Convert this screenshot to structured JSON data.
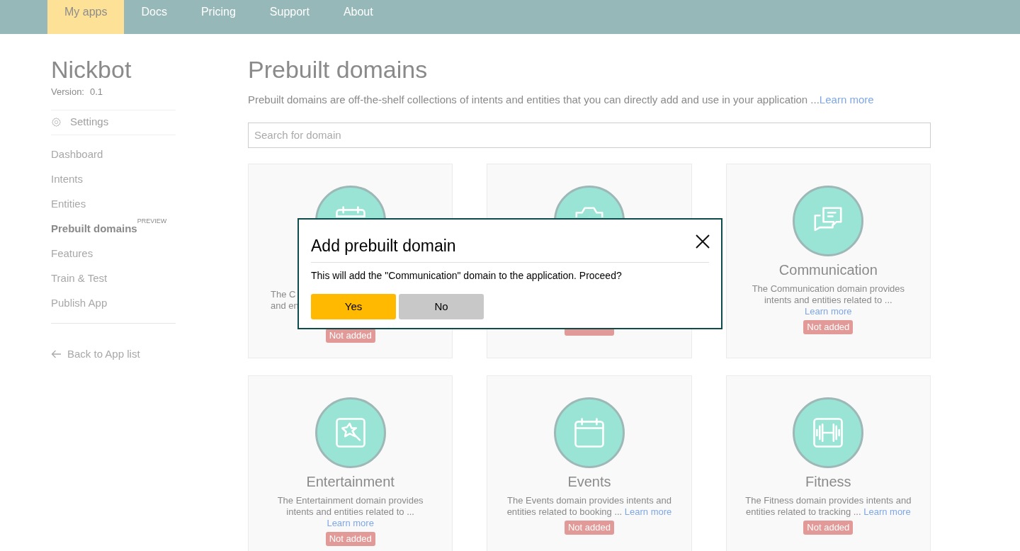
{
  "nav": [
    {
      "label": "My apps",
      "selected": true
    },
    {
      "label": "Docs",
      "selected": false
    },
    {
      "label": "Pricing",
      "selected": false
    },
    {
      "label": "Support",
      "selected": false
    },
    {
      "label": "About",
      "selected": false
    }
  ],
  "sidebar": {
    "app_name": "Nickbot",
    "version_label": "Version:",
    "version": "0.1",
    "settings": "Settings",
    "items": [
      {
        "label": "Dashboard",
        "selected": false
      },
      {
        "label": "Intents",
        "selected": false
      },
      {
        "label": "Entities",
        "selected": false
      },
      {
        "label": "Prebuilt domains",
        "selected": true,
        "badge": "PREVIEW"
      },
      {
        "label": "Features",
        "selected": false
      },
      {
        "label": "Train & Test",
        "selected": false
      },
      {
        "label": "Publish App",
        "selected": false
      }
    ],
    "back_link": "Back to App list"
  },
  "main": {
    "title": "Prebuilt domains",
    "description": "Prebuilt domains are off-the-shelf collections of intents and entities that you can directly add and use in your application ...",
    "learn_more": "Learn more",
    "search": {
      "placeholder": "Search for domain"
    },
    "cards": [
      {
        "kind": "calendar",
        "lines": [
          "The C",
          "and en"
        ],
        "status": "Not added",
        "added": false
      },
      {
        "kind": "camera",
        "added": false
      },
      {
        "kind": "chat",
        "title": "Communication",
        "description": "The Communication domain provides intents and entities related to ...",
        "link": "Learn more",
        "status": "Not added",
        "added": false
      },
      {
        "kind": "star",
        "title": "Entertainment",
        "description": "The Entertainment domain provides intents and entities related to ...",
        "link": "Learn more",
        "status": "Not added",
        "added": false
      },
      {
        "kind": "calendar",
        "title": "Events",
        "description": "The Events domain provides intents and entities related to booking ...",
        "link": "Learn more",
        "status": "Not added",
        "added": false
      },
      {
        "kind": "dumbbell",
        "title": "Fitness",
        "description": "The Fitness domain provides intents and entities related to tracking ...",
        "link": "Learn more",
        "status": "Not added",
        "added": false
      }
    ]
  },
  "dialog": {
    "title": "Add prebuilt domain",
    "message": "This will add the \"Communication\" domain to the application. Proceed?",
    "buttons": [
      {
        "label": "Yes",
        "kind": "primary"
      },
      {
        "label": "No",
        "kind": "secondary"
      }
    ]
  }
}
